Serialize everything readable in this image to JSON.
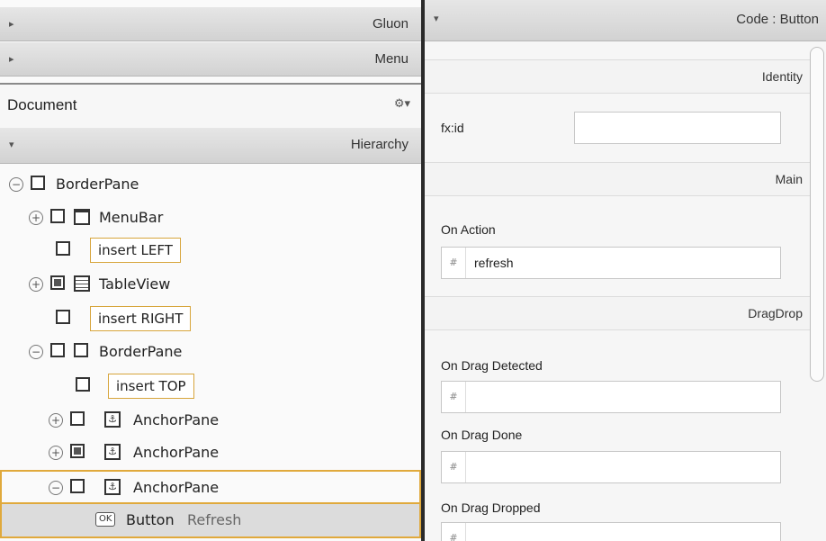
{
  "library": {
    "sections": [
      {
        "label": "Gluon",
        "arrow": "▸"
      },
      {
        "label": "Menu",
        "arrow": "▸"
      }
    ]
  },
  "document": {
    "title": "Document",
    "gear": "⚙▾"
  },
  "hierarchy": {
    "title": "Hierarchy",
    "arrow": "▾",
    "rows": [
      {
        "kind": "node",
        "expander": "−",
        "name": "BorderPane"
      },
      {
        "kind": "node",
        "expander": "+",
        "name": "MenuBar"
      },
      {
        "kind": "slot",
        "name": "insert LEFT"
      },
      {
        "kind": "node",
        "expander": "+",
        "name": "TableView"
      },
      {
        "kind": "slot",
        "name": "insert RIGHT"
      },
      {
        "kind": "node",
        "expander": "−",
        "name": "BorderPane"
      },
      {
        "kind": "slot",
        "name": "insert TOP"
      },
      {
        "kind": "node",
        "expander": "+",
        "name": "AnchorPane"
      },
      {
        "kind": "node",
        "expander": "+",
        "name": "AnchorPane"
      },
      {
        "kind": "node",
        "expander": "−",
        "name": "AnchorPane"
      },
      {
        "kind": "button",
        "badge": "OK",
        "name": "Button",
        "text": "Refresh"
      }
    ]
  },
  "inspector": {
    "title": "Code : Button",
    "arrow": "▾",
    "sections": {
      "identity": "Identity",
      "main": "Main",
      "dragdrop": "DragDrop"
    },
    "fields": {
      "fxid": {
        "label": "fx:id",
        "value": ""
      },
      "on_action": {
        "label": "On Action",
        "hash": "#",
        "value": "refresh"
      },
      "on_drag_detected": {
        "label": "On Drag Detected",
        "hash": "#",
        "value": ""
      },
      "on_drag_done": {
        "label": "On Drag Done",
        "hash": "#",
        "value": ""
      },
      "on_drag_dropped": {
        "label": "On Drag Dropped",
        "hash": "#",
        "value": ""
      }
    }
  }
}
